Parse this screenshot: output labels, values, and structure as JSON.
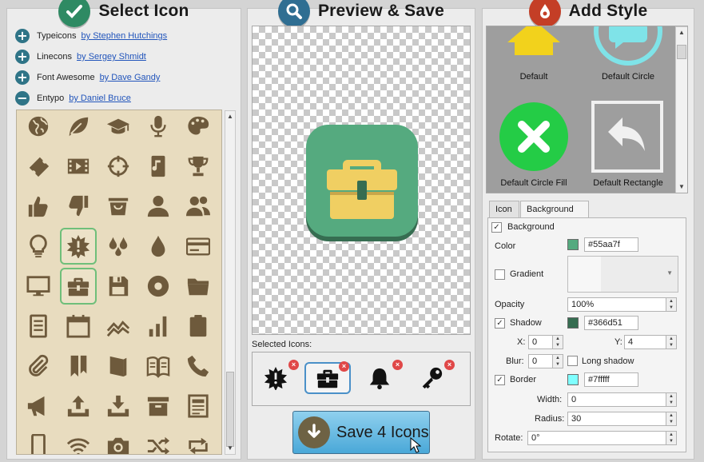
{
  "panels": {
    "select": {
      "title": "Select Icon"
    },
    "preview": {
      "title": "Preview & Save"
    },
    "style": {
      "title": "Add Style"
    }
  },
  "libraries": [
    {
      "name": "Typeicons",
      "author": "by Stephen Hutchings",
      "toggle": "+"
    },
    {
      "name": "Linecons",
      "author": "by Sergey Shmidt",
      "toggle": "+"
    },
    {
      "name": "Font Awesome",
      "author": "by Dave Gandy",
      "toggle": "+"
    },
    {
      "name": "Entypo",
      "author": "by Daniel Bruce",
      "toggle": "−"
    }
  ],
  "icon_grid": {
    "color": "#6e5a3c",
    "rows": [
      [
        "globe-icon",
        "leaf-icon",
        "graduation-cap-icon",
        "microphone-icon",
        "palette-icon"
      ],
      [
        "ticket-icon",
        "film-icon",
        "target-icon",
        "music-note-icon",
        "trophy-icon"
      ],
      [
        "thumbs-up-icon",
        "thumbs-down-icon",
        "bag-icon",
        "user-icon",
        "users-icon"
      ],
      [
        "lightbulb-icon",
        "alert-burst-icon",
        "droplets-icon",
        "drop-icon",
        "credit-card-icon"
      ],
      [
        "monitor-icon",
        "briefcase-icon",
        "floppy-disk-icon",
        "record-icon",
        "folder-icon"
      ],
      [
        "document-icon",
        "calendar-icon",
        "line-chart-icon",
        "bar-chart-icon",
        "clipboard-icon"
      ],
      [
        "paperclip-icon",
        "bookmarks-icon",
        "book-icon",
        "open-book-icon",
        "phone-icon"
      ],
      [
        "megaphone-icon",
        "upload-icon",
        "download-icon",
        "archive-icon",
        "newspaper-icon"
      ],
      [
        "mobile-icon",
        "wifi-icon",
        "camera-icon",
        "shuffle-icon",
        "loop-icon"
      ]
    ]
  },
  "preview": {
    "icon": "briefcase-icon",
    "background": "#55aa7f",
    "shadow": "#366d51",
    "glyph_color": "#f0cf62"
  },
  "selected_icons": {
    "label": "Selected Icons:",
    "items": [
      "alert-burst-icon",
      "briefcase-icon",
      "bell-icon",
      "key-icon"
    ]
  },
  "save_button": {
    "label": "Save 4 Icons"
  },
  "styles": [
    {
      "label": "Default"
    },
    {
      "label": "Default Circle"
    },
    {
      "label": "Default Circle Fill"
    },
    {
      "label": "Default Rectangle"
    }
  ],
  "tabs": [
    {
      "label": "Icon"
    },
    {
      "label": "Background"
    }
  ],
  "properties": {
    "background_label": "Background",
    "color_label": "Color",
    "color_value": "#55aa7f",
    "gradient_label": "Gradient",
    "opacity_label": "Opacity",
    "opacity_value": "100%",
    "shadow_label": "Shadow",
    "shadow_value": "#366d51",
    "x_label": "X:",
    "x_value": "0",
    "y_label": "Y:",
    "y_value": "4",
    "blur_label": "Blur:",
    "blur_value": "0",
    "long_shadow_label": "Long shadow",
    "border_label": "Border",
    "border_value": "#7fffff",
    "width_label": "Width:",
    "width_value": "0",
    "radius_label": "Radius:",
    "radius_value": "30",
    "rotate_label": "Rotate:",
    "rotate_value": "0°"
  }
}
